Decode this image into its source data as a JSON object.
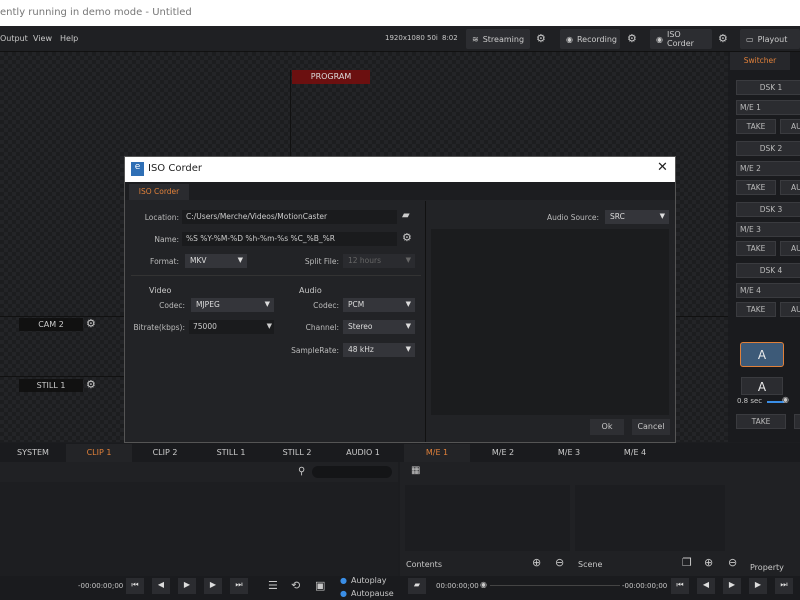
{
  "window": {
    "title": "ently running in demo mode - Untitled"
  },
  "menu": [
    "Output",
    "View",
    "Help"
  ],
  "toolbar": {
    "resolution": "1920x1080 50i",
    "time": "8:02",
    "streaming": "Streaming",
    "recording": "Recording",
    "iso_corder": "ISO Corder",
    "playout": "Playout"
  },
  "preview": {
    "program_label": "PROGRAM",
    "sources": [
      "CAM 2",
      "STILL 1"
    ]
  },
  "switcher": {
    "tab": "Switcher",
    "dsk": [
      "DSK 1",
      "DSK 2",
      "DSK 3",
      "DSK 4"
    ],
    "me": [
      "M/E 1",
      "M/E 2",
      "M/E 3",
      "M/E 4"
    ],
    "take": "TAKE",
    "auto": "AU",
    "a_active": "A",
    "a": "A",
    "duration": "0.8 sec"
  },
  "dialog": {
    "title": "ISO Corder",
    "tab": "ISO Corder",
    "location_label": "Location:",
    "location": "C:/Users/Merche/Videos/MotionCaster",
    "name_label": "Name:",
    "name": "%S %Y-%M-%D %h-%m-%s %C_%B_%R",
    "format_label": "Format:",
    "format": "MKV",
    "split_label": "Split File:",
    "split": "12 hours",
    "video_heading": "Video",
    "audio_heading": "Audio",
    "vcodec_label": "Codec:",
    "vcodec": "MJPEG",
    "bitrate_label": "Bitrate(kbps):",
    "bitrate": "75000",
    "acodec_label": "Codec:",
    "acodec": "PCM",
    "channel_label": "Channel:",
    "channel": "Stereo",
    "samplerate_label": "SampleRate:",
    "samplerate": "48 kHz",
    "audio_source_label": "Audio Source:",
    "audio_source": "SRC",
    "ok": "Ok",
    "cancel": "Cancel"
  },
  "bottom": {
    "left_tabs": [
      "SYSTEM",
      "CLIP 1",
      "CLIP 2",
      "STILL 1",
      "STILL 2",
      "AUDIO 1"
    ],
    "right_tabs": [
      "M/E 1",
      "M/E 2",
      "M/E 3",
      "M/E 4"
    ],
    "left_time": "-00:00:00;00",
    "autoplay": "Autoplay",
    "autopause": "Autopause",
    "contents": "Contents",
    "scene": "Scene",
    "property": "Property",
    "right_time_start": "00:00:00;00",
    "right_time_end": "-00:00:00;00"
  },
  "colors": {
    "accent": "#e0803a",
    "program": "#6b1010",
    "active_blue": "#3d5a78"
  }
}
